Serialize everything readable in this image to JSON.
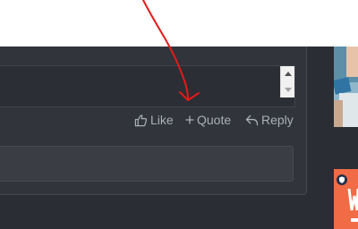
{
  "post_actions": {
    "like_label": "Like",
    "quote_label": "Quote",
    "reply_label": "Reply"
  },
  "icons": {
    "like": "thumbs-up-icon",
    "quote": "plus-icon",
    "reply": "reply-arrow-icon",
    "badge": "shield-icon"
  },
  "colors": {
    "page_background": "#2a2d33",
    "card_background": "#31343a",
    "action_text": "#aab0b8",
    "annotation": "#e41a1a"
  }
}
